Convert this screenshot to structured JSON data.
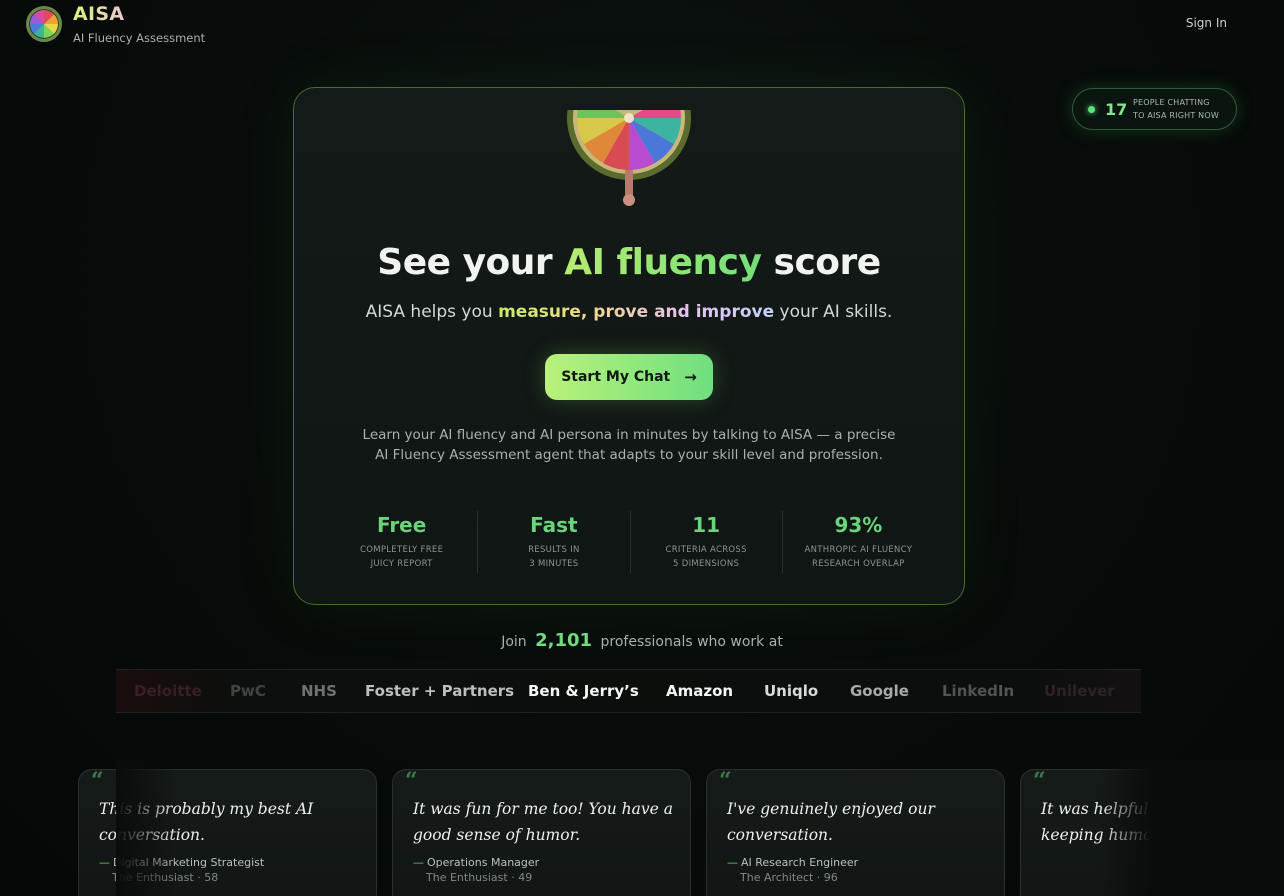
{
  "header": {
    "brand": "AISA",
    "brand_sub": "AI Fluency Assessment",
    "sign_in": "Sign In"
  },
  "live": {
    "count": "17",
    "text_line1": "PEOPLE CHATTING",
    "text_line2": "TO AISA RIGHT NOW"
  },
  "hero": {
    "headline_pre": "See your ",
    "headline_accent": "AI fluency",
    "headline_post": " score",
    "sub_pre": "AISA helps you ",
    "sub_highlight": "measure, prove and improve",
    "sub_post": " your AI skills.",
    "cta_label": "Start My Chat",
    "cta_icon": "arrow-right-icon",
    "description": "Learn your AI fluency and AI persona in minutes by talking to AISA — a precise AI Fluency Assessment agent that adapts to your skill level and profession."
  },
  "stats": [
    {
      "value": "Free",
      "label1": "COMPLETELY FREE",
      "label2": "JUICY REPORT"
    },
    {
      "value": "Fast",
      "label1": "RESULTS IN",
      "label2": "3 MINUTES"
    },
    {
      "value": "11",
      "label1": "CRITERIA ACROSS",
      "label2": "5 DIMENSIONS"
    },
    {
      "value": "93%",
      "label1": "ANTHROPIC AI FLUENCY",
      "label2": "RESEARCH OVERLAP"
    }
  ],
  "join": {
    "pre": "Join",
    "count": "2,101",
    "post": "professionals who work at"
  },
  "logos": [
    "Deloitte",
    "PwC",
    "NHS",
    "Foster + Partners",
    "Ben & Jerry’s",
    "Amazon",
    "Uniqlo",
    "Google",
    "LinkedIn",
    "Unilever"
  ],
  "testimonials": [
    {
      "quote": "This is probably my best AI conversation.",
      "role": "Digital Marketing Strategist",
      "persona": "The Enthusiast · 58"
    },
    {
      "quote": "It was fun for me too! You have a good sense of humor.",
      "role": "Operations Manager",
      "persona": "The Enthusiast · 49"
    },
    {
      "quote": "I've genuinely enjoyed our conversation.",
      "role": "AI Research Engineer",
      "persona": "The Architect · 96"
    },
    {
      "quote": "It was helpful to use AI as a Q keeping humor center.",
      "role": "",
      "persona": ""
    }
  ],
  "colors": {
    "accent_green": "#69d47a",
    "cta_start": "#b9f27a",
    "cta_end": "#6fdf7f",
    "background": "#070b09"
  }
}
